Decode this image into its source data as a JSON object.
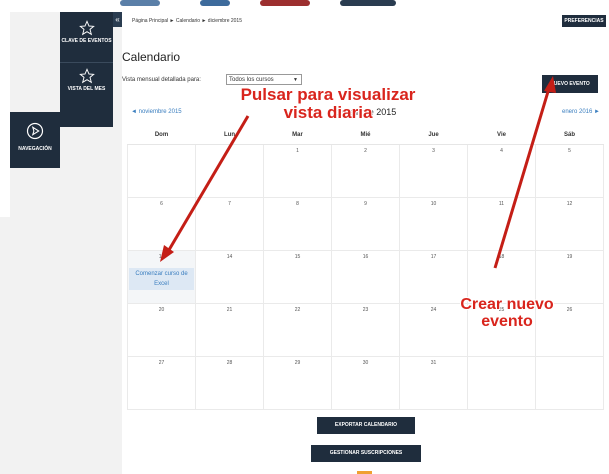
{
  "sidebar": {
    "items": [
      {
        "label": "CLAVE DE EVENTOS",
        "icon": "star-icon"
      },
      {
        "label": "VISTA DEL MES",
        "icon": "star-icon"
      }
    ],
    "nav": {
      "label": "NAVEGACIÓN",
      "icon": "navigation-icon"
    }
  },
  "collapse_icon": "«",
  "breadcrumb": [
    "Página Principal",
    "Calendario",
    "diciembre 2015"
  ],
  "breadcrumb_sep": "►",
  "preferences_label": "PREFERENCIAS",
  "page_title": "Calendario",
  "filter": {
    "label": "Vista mensual detallada para:",
    "value": "Todos los cursos"
  },
  "new_event_label": "NUEVO EVENTO",
  "calendar": {
    "prev_month": "◄ noviembre 2015",
    "next_month": "enero 2016 ►",
    "month_title": "diciembre 2015",
    "weekdays": [
      "Dom",
      "Lun",
      "Mar",
      "Mié",
      "Jue",
      "Vie",
      "Sáb"
    ],
    "weeks": [
      [
        "",
        "",
        "1",
        "2",
        "3",
        "4",
        "5"
      ],
      [
        "6",
        "7",
        "8",
        "9",
        "10",
        "11",
        "12"
      ],
      [
        "13",
        "14",
        "15",
        "16",
        "17",
        "18",
        "19"
      ],
      [
        "20",
        "21",
        "22",
        "23",
        "24",
        "25",
        "26"
      ],
      [
        "27",
        "28",
        "29",
        "30",
        "31",
        "",
        ""
      ]
    ],
    "event": {
      "day": "13",
      "title": "Comenzar curso de Excel"
    }
  },
  "export_label": "EXPORTAR CALENDARIO",
  "manage_label": "GESTIONAR SUSCRIPCIONES",
  "annotations": {
    "daily_view": "Pulsar para visualizar vista diaria",
    "new_event": "Crear nuevo evento"
  },
  "colors": {
    "sidebar": "#1f2d3d",
    "link": "#3a7ebf",
    "annotation": "#d9251d"
  }
}
